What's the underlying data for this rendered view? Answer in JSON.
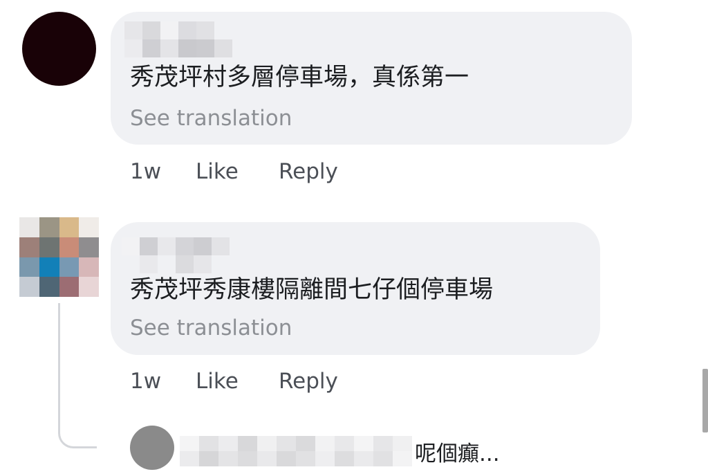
{
  "comments": [
    {
      "text": "秀茂坪村多層停車場，真係第一￼￼",
      "see_translation": "See translation",
      "time": "1w",
      "like": "Like",
      "reply": "Reply"
    },
    {
      "text": "秀茂坪秀康樓隔離間七仔個停車場",
      "see_translation": "See translation",
      "time": "1w",
      "like": "Like",
      "reply": "Reply"
    }
  ],
  "reply_preview": {
    "text": "呢個癲..."
  },
  "colors": {
    "bubble_bg": "#f0f1f4",
    "secondary_text": "#8c8f94",
    "action_text": "#4b4f56",
    "thread_line": "#d4d6da",
    "avatar_dark": "#190207",
    "avatar_grey": "#8a8a8a"
  }
}
